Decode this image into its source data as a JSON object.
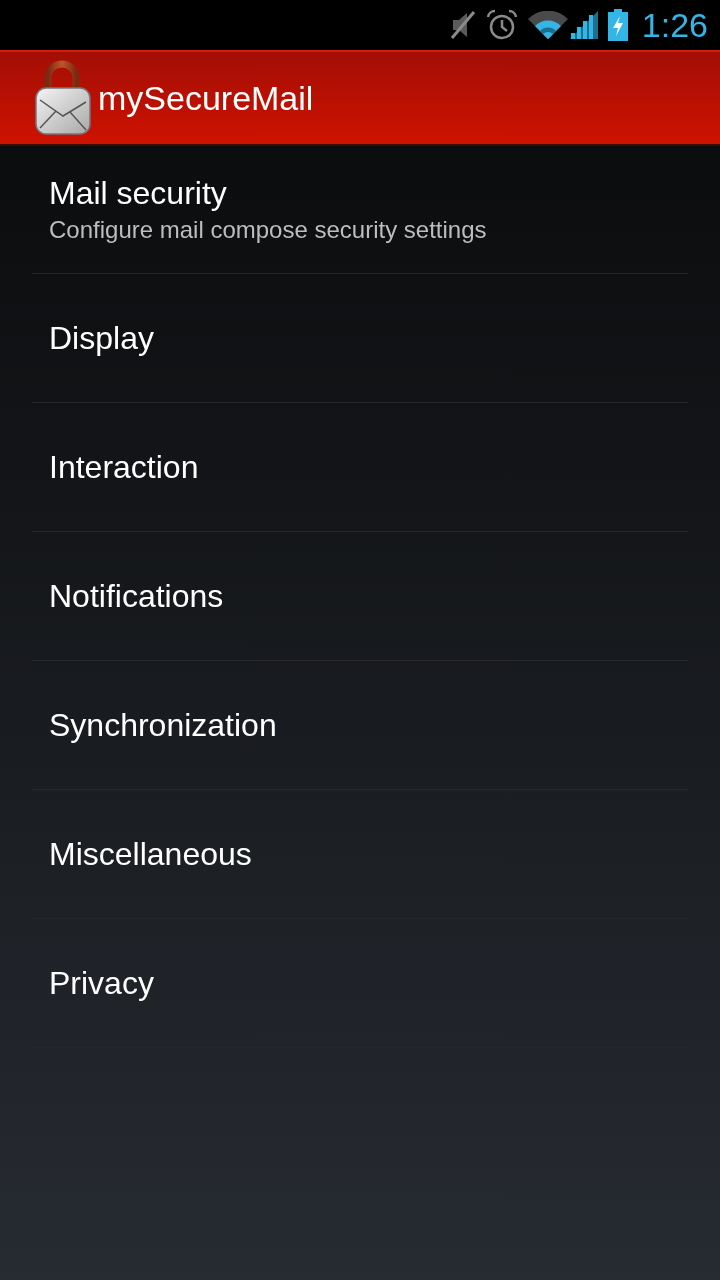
{
  "status_bar": {
    "time": "1:26"
  },
  "app_bar": {
    "title": "mySecureMail"
  },
  "settings": [
    {
      "title": "Mail security",
      "summary": "Configure mail compose security settings"
    },
    {
      "title": "Display"
    },
    {
      "title": "Interaction"
    },
    {
      "title": "Notifications"
    },
    {
      "title": "Synchronization"
    },
    {
      "title": "Miscellaneous"
    },
    {
      "title": "Privacy"
    }
  ]
}
